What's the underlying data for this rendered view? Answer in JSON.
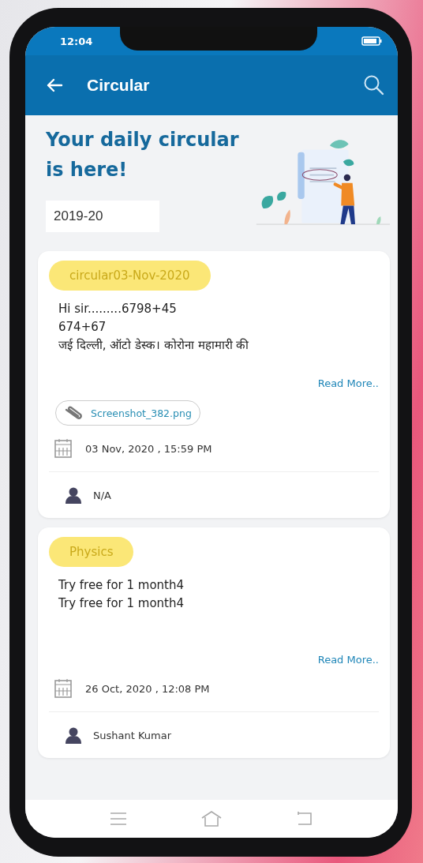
{
  "status_bar": {
    "time": "12:04"
  },
  "app_bar": {
    "title": "Circular"
  },
  "banner": {
    "heading": "Your daily circular is here!",
    "session": "2019-20"
  },
  "circulars": [
    {
      "tag": "circular03-Nov-2020",
      "lines": [
        "Hi sir.........6798+45",
        "674+67",
        "जई दिल्ली, ऑटो डेस्क। कोरोना महामारी की"
      ],
      "read_more": "Read More..",
      "attachment": "Screenshot_382.png",
      "date": "03 Nov, 2020 , 15:59 PM",
      "author": "N/A"
    },
    {
      "tag": "Physics",
      "lines": [
        "Try free for 1 month4",
        "Try free for 1 month4"
      ],
      "read_more": "Read More..",
      "date": "26 Oct, 2020 , 12:08 PM",
      "author": "Sushant Kumar"
    }
  ]
}
